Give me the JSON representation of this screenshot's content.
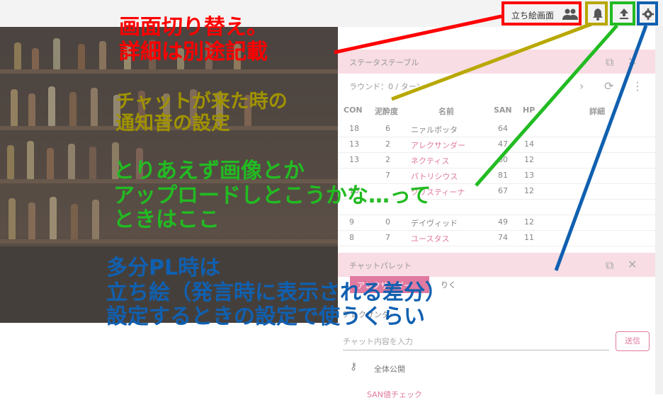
{
  "toolbar": {
    "standing_btn_label": "立ち絵画面",
    "buttons": [
      {
        "name": "standing-picture-screen-button",
        "icon": "people-icon",
        "border": "#ff0000"
      },
      {
        "name": "notification-sound-button",
        "icon": "bell-icon",
        "border": "#b8a800"
      },
      {
        "name": "upload-button",
        "icon": "upload-icon",
        "border": "#22bb22"
      },
      {
        "name": "settings-button",
        "icon": "gear-icon",
        "border": "#1060b0"
      }
    ]
  },
  "status_panel": {
    "title": "ステータステーブル",
    "round_text": "ラウンド：0 / ターン",
    "columns": [
      "CON",
      "泥酔度",
      "名前",
      "SAN",
      "HP",
      "詳細"
    ],
    "rows": [
      {
        "con": "18",
        "drunk": "6",
        "name": "ニァルボッタ",
        "san": "64",
        "hp": "",
        "pink": false
      },
      {
        "con": "13",
        "drunk": "2",
        "name": "アレクサンダー",
        "san": "47",
        "hp": "14",
        "pink": true
      },
      {
        "con": "13",
        "drunk": "2",
        "name": "ネクティス",
        "san": "60",
        "hp": "12",
        "pink": true
      },
      {
        "con": "",
        "drunk": "7",
        "name": "パトリシウス",
        "san": "81",
        "hp": "13",
        "pink": true
      },
      {
        "con": "10",
        "drunk": "",
        "name": "クリスティーナ",
        "san": "67",
        "hp": "12",
        "pink": true
      },
      {
        "con": "",
        "drunk": "",
        "name": "",
        "san": "",
        "hp": "",
        "pink": false
      },
      {
        "con": "9",
        "drunk": "0",
        "name": "デイヴィッド",
        "san": "49",
        "hp": "12",
        "pink": false
      },
      {
        "con": "8",
        "drunk": "7",
        "name": "ユースタス",
        "san": "74",
        "hp": "11",
        "pink": true
      }
    ]
  },
  "chat_palette": {
    "title": "チャットパレット",
    "selected_character": "アレクサンダー",
    "tab_other": "りく",
    "sender_label": "アレクサンダー",
    "input_placeholder": "チャット内容を入力",
    "send_label": "送信",
    "visibility_label": "全体公開",
    "footer_text": "SAN値チェック"
  },
  "annotations": {
    "red": "画面切り替え。\n詳細は別途記載",
    "olive": "チャットが来た時の\n通知音の設定",
    "green": "とりあえず画像とか\nアップロードしとこうかな…って\nときはここ",
    "blue": "多分PL時は\n立ち絵（発言時に表示される差分）\n設定するときの設定で使うくらい"
  },
  "colors": {
    "red": "#ff0000",
    "olive": "#b8a800",
    "green": "#22bb22",
    "blue": "#1060b0",
    "accent_pink": "#e07aa0",
    "panel_header": "#f8dde4"
  }
}
